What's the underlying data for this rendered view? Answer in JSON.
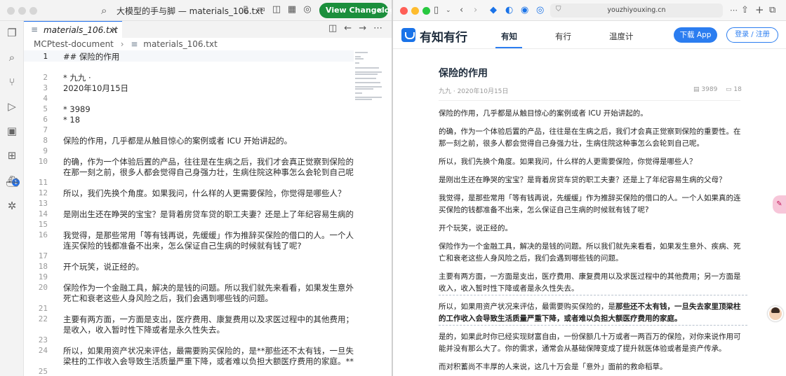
{
  "editor": {
    "window_title": "大模型的手与脚 — materials_106.txt",
    "changelog_button": "View Changelog",
    "changelog_close": "×",
    "tab": {
      "label": "materials_106.txt",
      "close": "×"
    },
    "breadcrumb": [
      "MCPtest-document",
      "materials_106.txt"
    ],
    "extensions_badge": "1",
    "lines": [
      {
        "n": "1",
        "text": "## 保险的作用",
        "active": true
      },
      {
        "n": "",
        "text": ""
      },
      {
        "n": "2",
        "text": "* 九九 ·"
      },
      {
        "n": "3",
        "text": "  2020年10月15日"
      },
      {
        "n": "4",
        "text": ""
      },
      {
        "n": "5",
        "text": "* 3989"
      },
      {
        "n": "6",
        "text": "* 18"
      },
      {
        "n": "7",
        "text": ""
      },
      {
        "n": "8",
        "text": "保险的作用，几乎都是从触目惊心的案例或者 ICU 开始讲起的。"
      },
      {
        "n": "9",
        "text": ""
      },
      {
        "n": "10",
        "text": "的确，作为一个体验后置的产品，往往是在生病之后，我们才会真正觉察到保险的重要性。"
      },
      {
        "n": "",
        "text": "在那一刻之前，很多人都会觉得自己身强力壮，生病住院这种事怎么会轮到自己呢。"
      },
      {
        "n": "11",
        "text": ""
      },
      {
        "n": "12",
        "text": "所以，我们先换个角度。如果我问，什么样的人更需要保险，你觉得是哪些人？"
      },
      {
        "n": "13",
        "text": ""
      },
      {
        "n": "14",
        "text": "是刚出生还在睁哭的宝宝？是背着房贷车贷的职工夫妻？还是上了年纪容易生病的父母？"
      },
      {
        "n": "15",
        "text": ""
      },
      {
        "n": "16",
        "text": "我觉得，是那些常用「等有钱再说，先缓缓」作为推辞买保险的借口的人。一个人如果真的"
      },
      {
        "n": "",
        "text": "连买保险的钱都准备不出来，怎么保证自己生病的时候就有钱了呢?"
      },
      {
        "n": "17",
        "text": ""
      },
      {
        "n": "18",
        "text": "开个玩笑，说正经的。"
      },
      {
        "n": "19",
        "text": ""
      },
      {
        "n": "20",
        "text": "保险作为一个金融工具，解决的是钱的问题。所以我们就先来看看，如果发生意外、疾病、"
      },
      {
        "n": "",
        "text": "死亡和衰老这些人身风险之后，我们会遇到哪些钱的问题。"
      },
      {
        "n": "21",
        "text": ""
      },
      {
        "n": "22",
        "text": "主要有两方面，一方面是支出，医疗费用、康复费用以及求医过程中的其他费用；另一方面"
      },
      {
        "n": "",
        "text": "是收入，收入暂时性下降或者是永久性失去。"
      },
      {
        "n": "23",
        "text": ""
      },
      {
        "n": "24",
        "text": "所以，如果用资产状况来评估，最需要购买保险的，是**那些还不太有钱，一旦失去家里顶"
      },
      {
        "n": "",
        "text": "梁柱的工作收入会导致生活质量严重下降，或者难以负担大额医疗费用的家庭。**"
      },
      {
        "n": "25",
        "text": ""
      }
    ]
  },
  "browser": {
    "url": "youzhiyouxing.cn",
    "site": {
      "logo_text": "有知有行",
      "nav": [
        "有知",
        "有行",
        "温度计"
      ],
      "download_button": "下载 App",
      "login_button": "登录 / 注册"
    },
    "article": {
      "title": "保险的作用",
      "meta": "九九 · 2020年10月15日",
      "views": "3989",
      "comments": "18",
      "paragraphs": [
        "保险的作用，几乎都是从触目惊心的案例或者 ICU 开始讲起的。",
        "的确，作为一个体验后置的产品，往往是在生病之后，我们才会真正觉察到保险的重要性。在那一刻之前，很多人都会觉得自己身强力壮，生病住院这种事怎么会轮到自己呢。",
        "所以，我们先换个角度。如果我问，什么样的人更需要保险，你觉得是哪些人？",
        "是刚出生还在睁哭的宝宝？是背着房贷车贷的职工夫妻？还是上了年纪容易生病的父母？",
        "我觉得，是那些常用「等有钱再说，先缓缓」作为推辞买保险的借口的人。一个人如果真的连买保险的钱都准备不出来，怎么保证自己生病的时候就有钱了呢?",
        "开个玩笑，说正经的。",
        "保险作为一个金融工具，解决的是钱的问题。所以我们就先来看看，如果发生意外、疾病、死亡和衰老这些人身风险之后，我们会遇到哪些钱的问题。",
        "主要有两方面，一方面是支出，医疗费用、康复费用以及求医过程中的其他费用；另一方面是收入，收入暂时性下降或者是永久性失去。",
        "所以，如果用资产状况来评估，最需要购买保险的，是那些还不太有钱，一旦失去家里顶梁柱的工作收入会导致生活质量严重下降，或者难以负担大额医疗费用的家庭。",
        "是的，如果此时你已经实现财富自由，一份保额几十万或者一两百万的保险，对你来说作用可能并没有那么大了。你的需求，通常会从基础保障变成了提升就医体验或者是资产传承。",
        "而对积蓄尚不丰厚的人来说，这几十万会是「意外」面前的救命稻草。"
      ],
      "para9_plain": "所以，如果用资产状况来评估，最需要购买保险的，是",
      "para9_bold": "那些还不太有钱，一旦失去家里顶梁柱的工作收入会导致生活质量严重下降，或者难以负担大额医疗费用的家庭。"
    }
  }
}
